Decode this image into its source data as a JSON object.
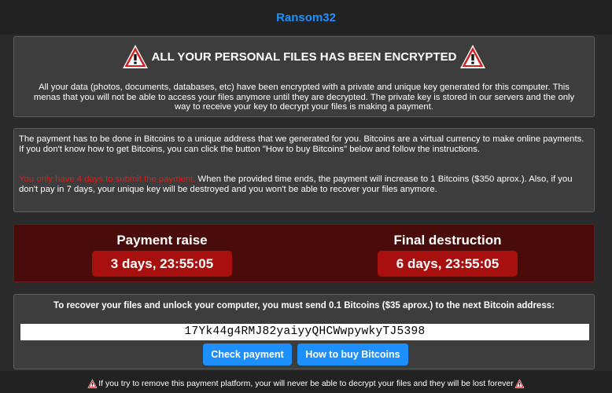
{
  "app": {
    "title": "Ransom32"
  },
  "warning_box": {
    "heading": "ALL YOUR PERSONAL FILES HAS BEEN ENCRYPTED",
    "icon": "warning-triangle-icon",
    "body": "All your data (photos, documents, databases, etc) have been encrypted with a private and unique key generated for this computer. This menas that you will not be able to access your files anymore until they are decrypted. The private key is stored in our servers and the only way to receive your key to decrypt your files is making a payment."
  },
  "info_box": {
    "paragraph1": "The payment has to be done in Bitcoins to a unique address that we generated for you. Bitcoins are a virtual currency to make online payments. If you don't know how to get Bitcoins, you can click the button \"How to buy Bitcoins\" below and follow the instructions.",
    "deadline": "You only have 4 days to submit the payment.",
    "paragraph2": " When the provided time ends, the payment will increase to 1 Bitcoins ($350 aprox.). Also, if you don't pay in 7 days, your unique key will be destroyed and you won't be able to recover your files anymore."
  },
  "timers": {
    "payment_raise": {
      "label": "Payment raise",
      "value": "3 days, 23:55:05"
    },
    "final_destruction": {
      "label": "Final destruction",
      "value": "6 days, 23:55:05"
    }
  },
  "payment": {
    "instructions": "To recover your files and unlock your computer, you must send 0.1 Bitcoins ($35 aprox.) to the next Bitcoin address:",
    "address": "17Yk44g4RMJ82yaiyyQHCWwpywkyTJ5398",
    "check_button": "Check payment",
    "buy_button": "How to buy Bitcoins"
  },
  "footer": {
    "text": "If you try to remove this payment platform, your will never be able to decrypt your files and they will be lost forever"
  },
  "colors": {
    "background": "#222222",
    "panel": "#3d3d3d",
    "accent_blue": "#1e8fff",
    "alert_red": "#e01a1a",
    "timer_red": "#a81010",
    "timer_panel": "#4a0b0b"
  }
}
